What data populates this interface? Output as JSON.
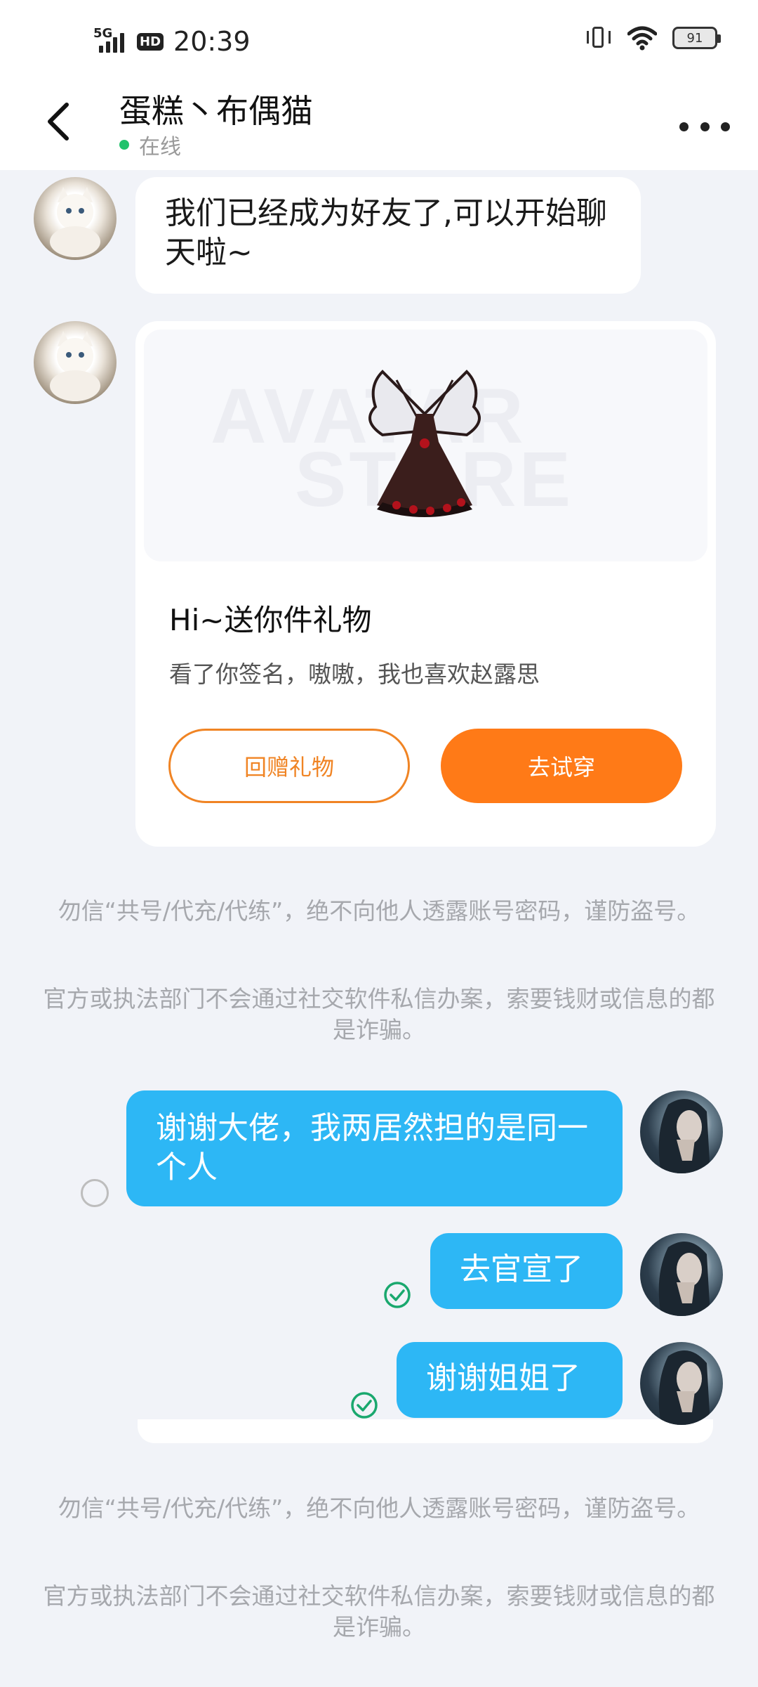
{
  "status_bar": {
    "network": "5G",
    "hd": "HD",
    "time": "20:39",
    "battery": "91"
  },
  "header": {
    "title": "蛋糕丶布偶猫",
    "status": "在线"
  },
  "messages": {
    "welcome": "我们已经成为好友了,可以开始聊天啦~",
    "gift": {
      "watermark_line1": "AVATAR",
      "watermark_line2": "STORE",
      "title": "Hi~送你件礼物",
      "note": "看了你签名，嗷嗷，我也喜欢赵露思",
      "return_gift_button": "回赠礼物",
      "try_on_button": "去试穿"
    },
    "sent": [
      "谢谢大佬，我两居然担的是同一个人",
      "去官宣了",
      "谢谢姐姐了"
    ]
  },
  "notices": {
    "notice_1": "勿信“共号/代充/代练”，绝不向他人透露账号密码，谨防盗号。",
    "notice_2": "官方或执法部门不会通过社交软件私信办案，索要钱财或信息的都是诈骗。",
    "notice_3": "勿信“共号/代充/代练”，绝不向他人透露账号密码，谨防盗号。",
    "notice_4": "官方或执法部门不会通过社交软件私信办案，索要钱财或信息的都是诈骗。"
  },
  "colors": {
    "accent": "#ff7a17",
    "bubble_out": "#2db7f5",
    "online": "#21c26b",
    "read": "#1aa86e"
  }
}
